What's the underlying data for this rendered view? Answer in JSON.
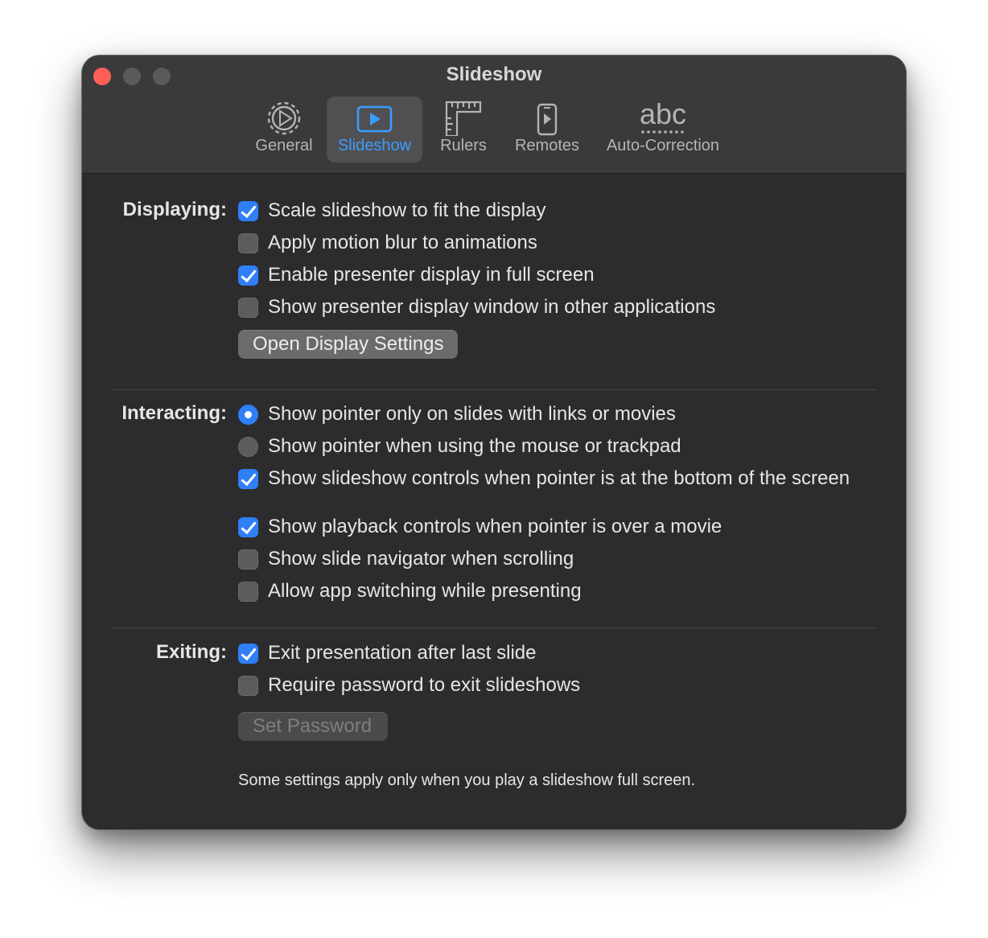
{
  "window": {
    "title": "Slideshow"
  },
  "tabs": [
    {
      "label": "General",
      "icon": "gear-icon",
      "active": false
    },
    {
      "label": "Slideshow",
      "icon": "play-icon",
      "active": true
    },
    {
      "label": "Rulers",
      "icon": "ruler-icon",
      "active": false
    },
    {
      "label": "Remotes",
      "icon": "phone-icon",
      "active": false
    },
    {
      "label": "Auto-Correction",
      "icon": "abc-icon",
      "active": false
    }
  ],
  "displaying": {
    "label": "Displaying:",
    "options": [
      {
        "label": "Scale slideshow to fit the display",
        "checked": true
      },
      {
        "label": "Apply motion blur to animations",
        "checked": false
      },
      {
        "label": "Enable presenter display in full screen",
        "checked": true
      },
      {
        "label": "Show presenter display window in other applications",
        "checked": false
      }
    ],
    "button_label": "Open Display Settings"
  },
  "interacting": {
    "label": "Interacting:",
    "radios": [
      {
        "label": "Show pointer only on slides with links or movies",
        "selected": true
      },
      {
        "label": "Show pointer when using the mouse or trackpad",
        "selected": false
      }
    ],
    "options": [
      {
        "label": "Show slideshow controls when pointer is at the bottom of the screen",
        "checked": true
      },
      {
        "label": "Show playback controls when pointer is over a movie",
        "checked": true
      },
      {
        "label": "Show slide navigator when scrolling",
        "checked": false
      },
      {
        "label": "Allow app switching while presenting",
        "checked": false
      }
    ]
  },
  "exiting": {
    "label": "Exiting:",
    "options": [
      {
        "label": "Exit presentation after last slide",
        "checked": true
      },
      {
        "label": "Require password to exit slideshows",
        "checked": false
      }
    ],
    "button_label": "Set Password",
    "button_enabled": false
  },
  "footnote": "Some settings apply only when you play a slideshow full screen.",
  "colors": {
    "accent": "#2f7ff7",
    "active_tab_text": "#3b9bff",
    "close_button": "#ff5f57"
  }
}
